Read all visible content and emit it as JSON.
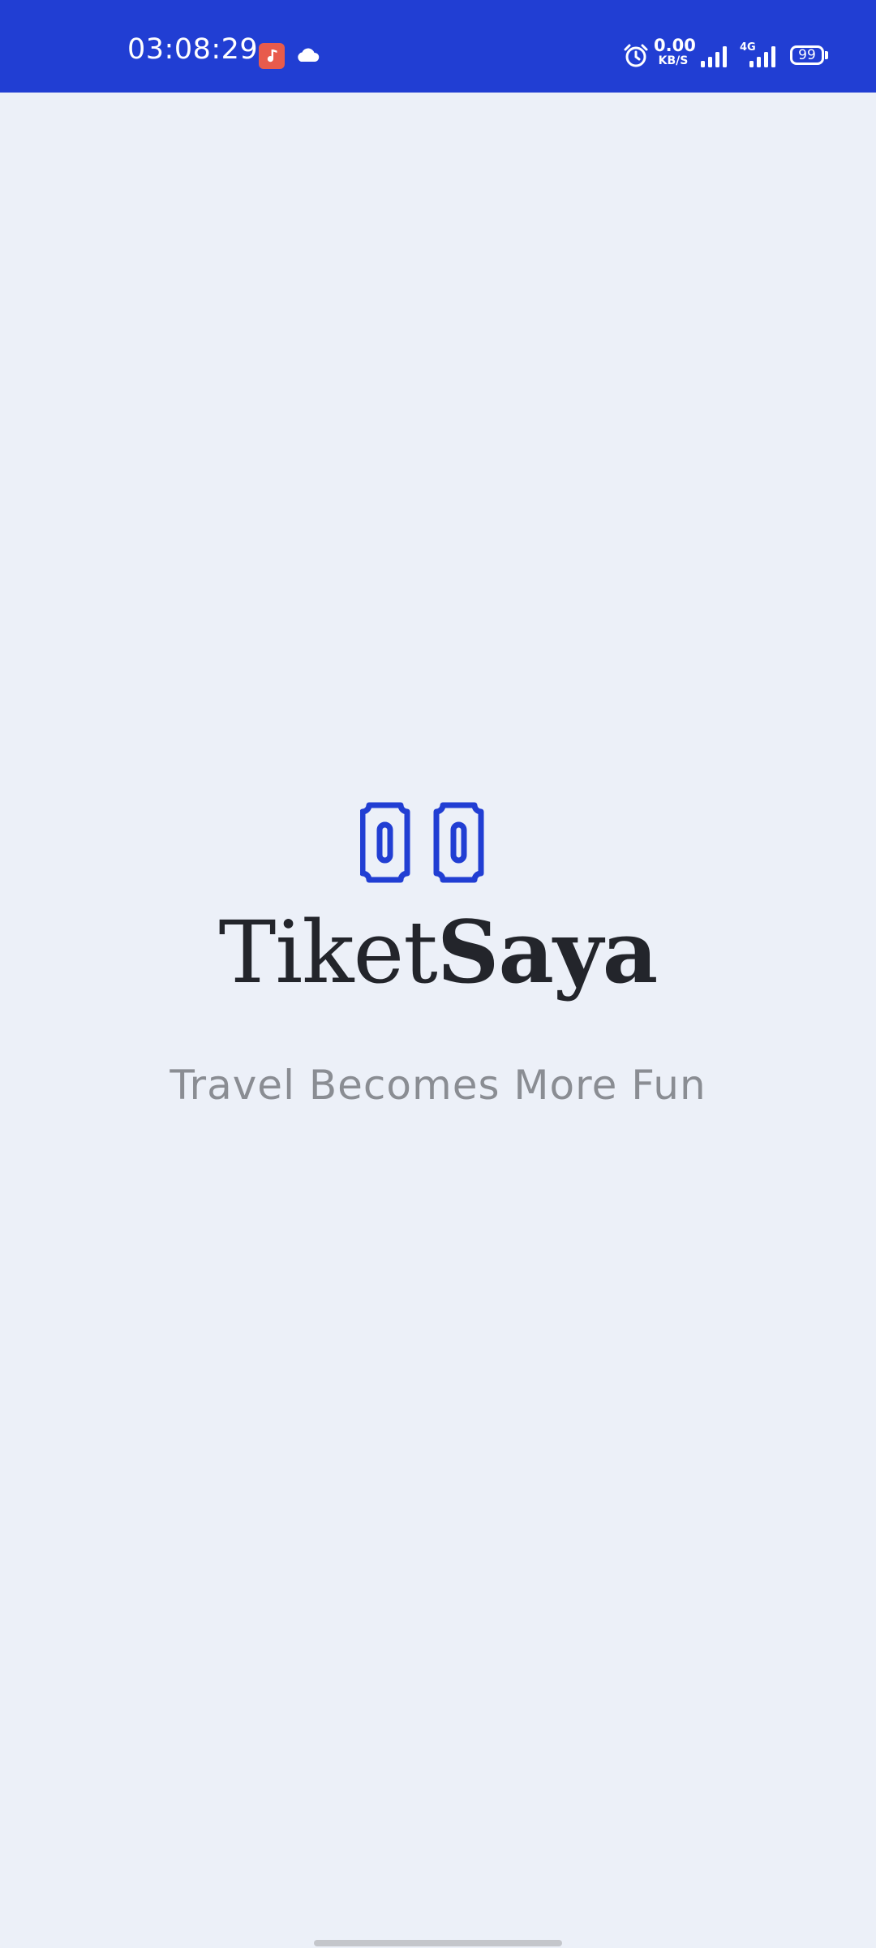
{
  "status_bar": {
    "time": "03:08:29",
    "network_speed_value": "0.00",
    "network_speed_unit": "KB/S",
    "network_type": "4G",
    "battery_level": "99",
    "icons": [
      "music-notification-icon",
      "cloud-icon",
      "alarm-icon",
      "signal-icon",
      "signal-4g-icon",
      "battery-icon"
    ]
  },
  "splash": {
    "logo_icon": "ticket-icon",
    "brand_light": "Tiket",
    "brand_bold": "Saya",
    "tagline": "Travel Becomes More Fun"
  },
  "colors": {
    "accent": "#213ED3",
    "background": "#ECF0F8",
    "brand_text": "#23252B",
    "tagline_text": "#8A8D93"
  }
}
